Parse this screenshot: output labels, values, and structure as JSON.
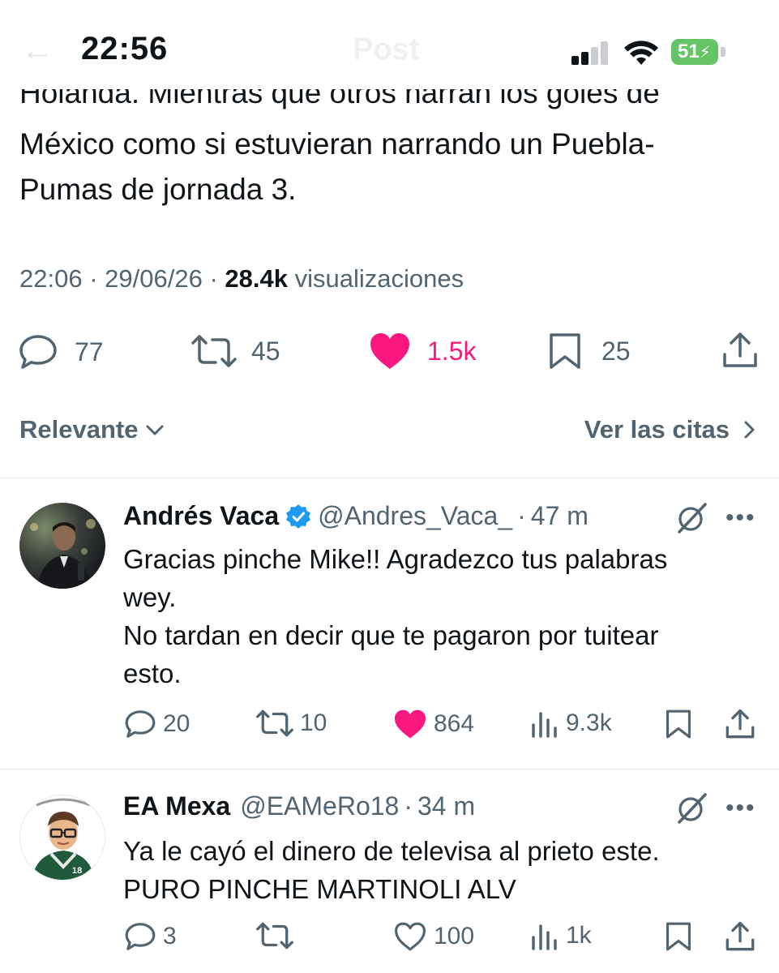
{
  "status_bar": {
    "time": "22:56",
    "battery": "51",
    "nav_title": "Post"
  },
  "tweet": {
    "cut_line": "Holanda. Mientras que otros narran los goles de",
    "lines": [
      "México como si estuvieran narrando un Puebla-",
      "Pumas de jornada 3."
    ],
    "time": "22:06",
    "date": "29/06/26",
    "views_count": "28.4k",
    "views_label": "visualizaciones",
    "replies": "77",
    "reposts": "45",
    "likes": "1.5k",
    "bookmarks": "25"
  },
  "replies_bar": {
    "sort_label": "Relevante",
    "quotes_label": "Ver las citas"
  },
  "replies": [
    {
      "name": "Andrés Vaca",
      "handle": "@Andres_Vaca_",
      "time": "47 m",
      "verified": true,
      "lines": [
        "Gracias pinche Mike!! Agradezco tus palabras",
        "wey.",
        "No tardan en decir que te pagaron por tuitear",
        "esto."
      ],
      "replies": "20",
      "reposts": "10",
      "likes": "864",
      "liked": true,
      "views": "9.3k"
    },
    {
      "name": "EA Mexa",
      "handle": "@EAMeRo18",
      "time": "34 m",
      "verified": false,
      "lines": [
        "Ya le cayó el dinero de televisa al prieto este.",
        "PURO PINCHE MARTINOLI ALV"
      ],
      "replies": "3",
      "reposts": "",
      "likes": "100",
      "liked": false,
      "views": "1k",
      "avatar_number": "18"
    }
  ],
  "colors": {
    "like_pink": "#f91880",
    "verified_blue": "#1d9bf0",
    "muted_text": "#536471",
    "battery_green": "#65c466"
  }
}
